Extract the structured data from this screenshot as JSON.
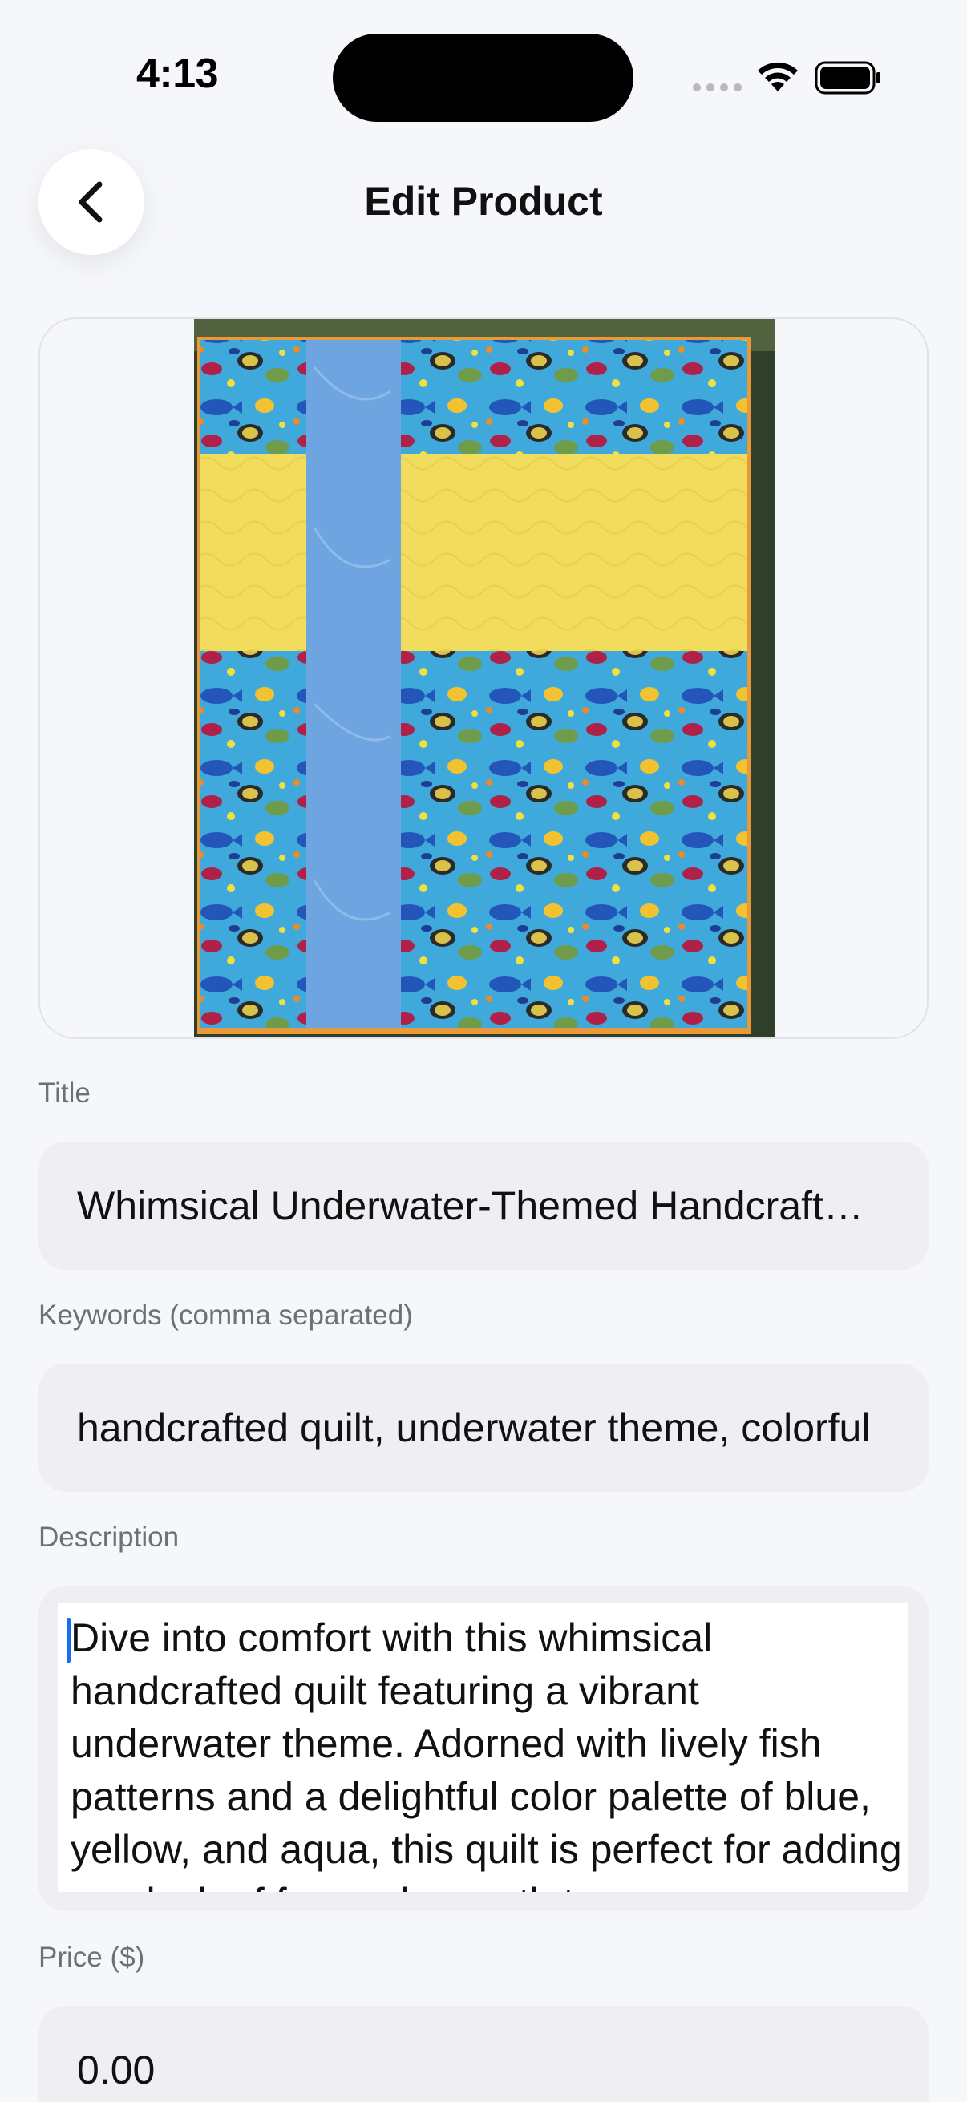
{
  "status_bar": {
    "time": "4:13"
  },
  "header": {
    "title": "Edit Product"
  },
  "form": {
    "title_label": "Title",
    "title_value": "Whimsical Underwater-Themed Handcrafted Quilt",
    "keywords_label": "Keywords (comma separated)",
    "keywords_value": "handcrafted quilt, underwater theme, colorful",
    "description_label": "Description",
    "description_value": "Dive into comfort with this whimsical handcrafted quilt featuring a vibrant underwater theme. Adorned with lively fish patterns and a delightful color palette of blue, yellow, and aqua, this quilt is perfect for adding a splash of fun and warmth to any",
    "price_label": "Price ($)",
    "price_value": "0.00"
  },
  "icons": {
    "back": "chevron-left-icon",
    "wifi": "wifi-icon",
    "battery": "battery-icon",
    "signal": "cellular-signal-icon"
  },
  "colors": {
    "background": "#f6f7fa",
    "field_background": "#eeeef3",
    "caret": "#1a6cf0",
    "quilt_blue": "#3fa9dc",
    "quilt_yellow": "#f2dc5d",
    "quilt_stripe": "#6ea4df"
  }
}
